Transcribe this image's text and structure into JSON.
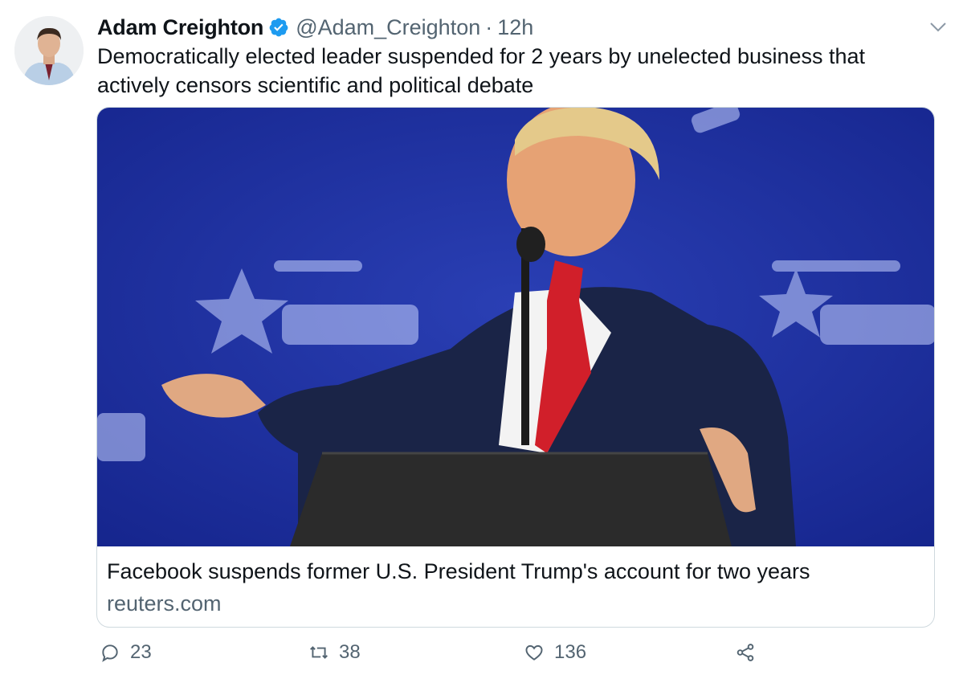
{
  "author": {
    "name": "Adam Creighton",
    "handle": "@Adam_Creighton",
    "separator": "·",
    "time": "12h",
    "verified": true
  },
  "tweet": {
    "text": "Democratically elected leader suspended for 2 years by unelected business that actively censors scientific and political debate"
  },
  "card": {
    "title": "Facebook suspends former U.S. President Trump's account for two years",
    "domain": "reuters.com",
    "image_desc_icon": "photo"
  },
  "actions": {
    "reply_count": "23",
    "retweet_count": "38",
    "like_count": "136"
  },
  "colors": {
    "verified_blue": "#1d9bf0",
    "secondary_text": "#536471",
    "primary_text": "#0f1419",
    "card_border": "#cfd9de"
  }
}
